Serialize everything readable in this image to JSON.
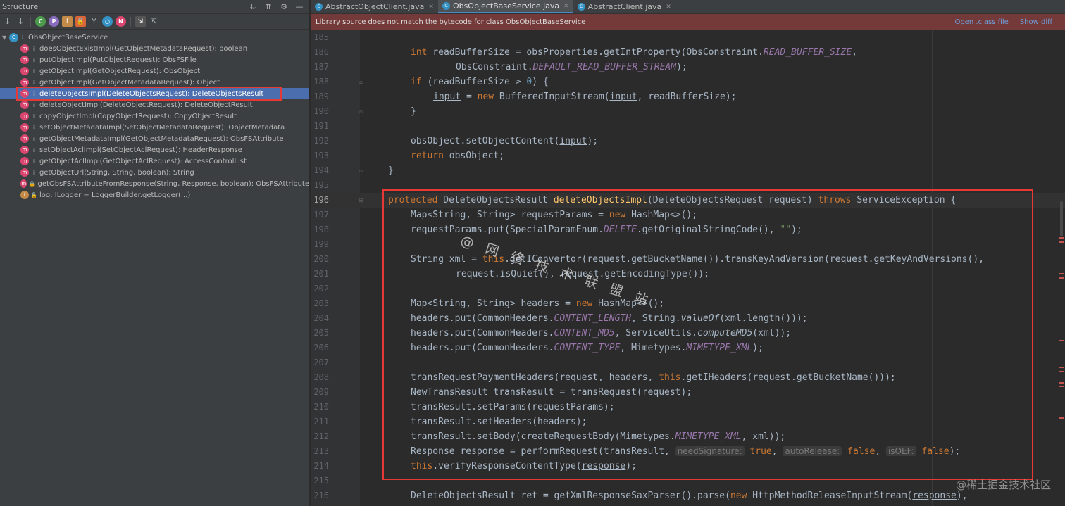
{
  "structure": {
    "title": "Structure",
    "root_class": "ObsObjectBaseService",
    "members": [
      {
        "kind": "m",
        "visibility": "public",
        "label": "doesObjectExistImpl(GetObjectMetadataRequest): boolean"
      },
      {
        "kind": "m",
        "visibility": "public",
        "label": "putObjectImpl(PutObjectRequest): ObsFSFile"
      },
      {
        "kind": "m",
        "visibility": "public",
        "label": "getObjectImpl(GetObjectRequest): ObsObject"
      },
      {
        "kind": "m",
        "visibility": "public",
        "label": "getObjectImpl(GetObjectMetadataRequest): Object"
      },
      {
        "kind": "m",
        "visibility": "public",
        "label": "deleteObjectsImpl(DeleteObjectsRequest): DeleteObjectsResult"
      },
      {
        "kind": "m",
        "visibility": "public",
        "label": "deleteObjectImpl(DeleteObjectRequest): DeleteObjectResult"
      },
      {
        "kind": "m",
        "visibility": "public",
        "label": "copyObjectImpl(CopyObjectRequest): CopyObjectResult"
      },
      {
        "kind": "m",
        "visibility": "public",
        "label": "setObjectMetadataImpl(SetObjectMetadataRequest): ObjectMetadata"
      },
      {
        "kind": "m",
        "visibility": "public",
        "label": "getObjectMetadataImpl(GetObjectMetadataRequest): ObsFSAttribute"
      },
      {
        "kind": "m",
        "visibility": "public",
        "label": "setObjectAclImpl(SetObjectAclRequest): HeaderResponse"
      },
      {
        "kind": "m",
        "visibility": "public",
        "label": "getObjectAclImpl(GetObjectAclRequest): AccessControlList"
      },
      {
        "kind": "m",
        "visibility": "public",
        "label": "getObjectUrl(String, String, boolean): String"
      },
      {
        "kind": "m",
        "visibility": "private",
        "label": "getObsFSAttributeFromResponse(String, Response, boolean): ObsFSAttribute"
      },
      {
        "kind": "f",
        "visibility": "private",
        "label": "log: ILogger = LoggerBuilder.getLogger(...)"
      }
    ],
    "selected_index": 4
  },
  "editor": {
    "tabs": [
      {
        "label": "AbstractObjectClient.java",
        "active": false
      },
      {
        "label": "ObsObjectBaseService.java",
        "active": true
      },
      {
        "label": "AbstractClient.java",
        "active": false
      }
    ],
    "banner": {
      "message": "Library source does not match the bytecode for class ObsObjectBaseService",
      "link_open_class": "Open .class file",
      "link_show_diff": "Show diff"
    },
    "current_line": "196",
    "lines": [
      {
        "n": "185"
      },
      {
        "n": "186"
      },
      {
        "n": "187"
      },
      {
        "n": "188"
      },
      {
        "n": "189"
      },
      {
        "n": "190"
      },
      {
        "n": "191"
      },
      {
        "n": "192"
      },
      {
        "n": "193"
      },
      {
        "n": "194"
      },
      {
        "n": "195"
      },
      {
        "n": "196"
      },
      {
        "n": "197"
      },
      {
        "n": "198"
      },
      {
        "n": "199"
      },
      {
        "n": "200"
      },
      {
        "n": "201"
      },
      {
        "n": "202"
      },
      {
        "n": "203"
      },
      {
        "n": "204"
      },
      {
        "n": "205"
      },
      {
        "n": "206"
      },
      {
        "n": "207"
      },
      {
        "n": "208"
      },
      {
        "n": "209"
      },
      {
        "n": "210"
      },
      {
        "n": "211"
      },
      {
        "n": "212"
      },
      {
        "n": "213"
      },
      {
        "n": "214"
      },
      {
        "n": "215"
      },
      {
        "n": "216"
      }
    ],
    "code": {
      "l186_kw": "int",
      "l186_a": " readBufferSize = obsProperties.getIntProperty(ObsConstraint.",
      "l186_const": "READ_BUFFER_SIZE",
      "l186_b": ",",
      "l187_a": "ObsConstraint.",
      "l187_const": "DEFAULT_READ_BUFFER_STREAM",
      "l187_b": ");",
      "l188_kw": "if",
      "l188_a": " (readBufferSize > ",
      "l188_num": "0",
      "l188_b": ") {",
      "l189_ul": "input",
      "l189_a": " = ",
      "l189_kw": "new",
      "l189_b": " BufferedInputStream(",
      "l189_ul2": "input",
      "l189_c": ", readBufferSize);",
      "l190": "}",
      "l192_a": "obsObject.setObjectContent(",
      "l192_ul": "input",
      "l192_b": ");",
      "l193_kw": "return",
      "l193_a": " obsObject;",
      "l194": "}",
      "l196_kw": "protected",
      "l196_a": " DeleteObjectsResult ",
      "l196_fn": "deleteObjectsImpl",
      "l196_b": "(DeleteObjectsRequest request) ",
      "l196_kw2": "throws",
      "l196_c": " ServiceException {",
      "l197_a": "Map<String, String> requestParams = ",
      "l197_kw": "new",
      "l197_b": " HashMap<>();",
      "l198_a": "requestParams.put(SpecialParamEnum.",
      "l198_const": "DELETE",
      "l198_b": ".getOriginalStringCode(), ",
      "l198_str": "\"\"",
      "l198_c": ");",
      "l200_a": "String xml = ",
      "l200_kw": "this",
      "l200_b": ".getIConvertor(request.getBucketName()).transKeyAndVersion(request.getKeyAndVersions(),",
      "l201_a": "request.isQuiet(), request.getEncodingType());",
      "l203_a": "Map<String, String> headers = ",
      "l203_kw": "new",
      "l203_b": " HashMap<>();",
      "l204_a": "headers.put(CommonHeaders.",
      "l204_const": "CONTENT_LENGTH",
      "l204_b": ", String.",
      "l204_sfn": "valueOf",
      "l204_c": "(xml.length()));",
      "l205_a": "headers.put(CommonHeaders.",
      "l205_const": "CONTENT_MD5",
      "l205_b": ", ServiceUtils.",
      "l205_sfn": "computeMD5",
      "l205_c": "(xml));",
      "l206_a": "headers.put(CommonHeaders.",
      "l206_const": "CONTENT_TYPE",
      "l206_b": ", Mimetypes.",
      "l206_const2": "MIMETYPE_XML",
      "l206_c": ");",
      "l208_a": "transRequestPaymentHeaders(request, headers, ",
      "l208_kw": "this",
      "l208_b": ".getIHeaders(request.getBucketName()));",
      "l209_a": "NewTransResult transResult = transRequest(request);",
      "l210_a": "transResult.setParams(requestParams);",
      "l211_a": "transResult.setHeaders(headers);",
      "l212_a": "transResult.setBody(createRequestBody(Mimetypes.",
      "l212_const": "MIMETYPE_XML",
      "l212_b": ", xml));",
      "l213_a": "Response response = performRequest(transResult, ",
      "l213_h1": "needSignature:",
      "l213_v1": "true",
      "l213_h2": "autoRelease:",
      "l213_v2": "false",
      "l213_h3": "isOEF:",
      "l213_v3": "false",
      "l213_b": ");",
      "l214_kw": "this",
      "l214_a": ".verifyResponseContentType(",
      "l214_ul": "response",
      "l214_b": ");",
      "l216_a": "DeleteObjectsResult ret = getXmlResponseSaxParser().parse(",
      "l216_kw": "new",
      "l216_b": " HttpMethodReleaseInputStream(",
      "l216_ul": "response",
      "l216_c": "),"
    }
  },
  "watermark": "@ 网 络 技 术 联 盟 站",
  "site_watermark": "@稀土掘金技术社区",
  "colors": {
    "accent_selection": "#4b6eaf",
    "banner_bg": "#743a3a",
    "highlight_box": "#e53935",
    "keyword": "#cc7832",
    "method_decl": "#ffc66d",
    "constant": "#9876aa"
  }
}
